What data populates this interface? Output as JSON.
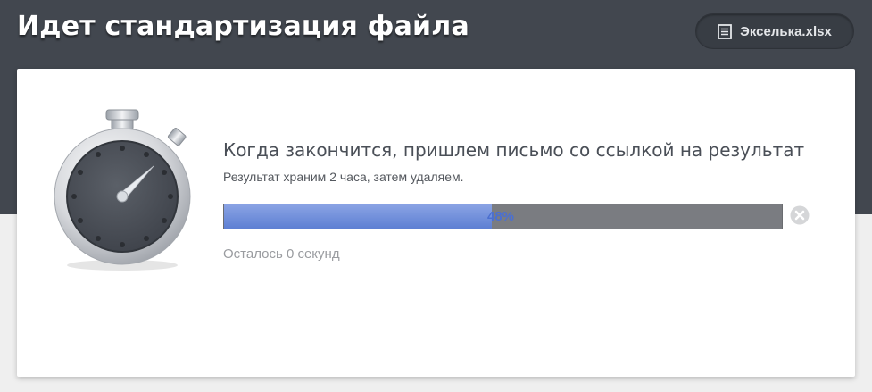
{
  "header": {
    "title": "Идет стандартизация файла",
    "file_name": "Экселька.xlsx",
    "file_icon": "document-icon"
  },
  "status": {
    "headline": "Когда закончится, пришлем письмо со ссылкой на результат",
    "note": "Результат храним 2 часа, затем удаляем.",
    "progress_percent": 48,
    "progress_label": "48%",
    "remaining": "Осталось 0 секунд",
    "cancel_icon": "close-circle-icon",
    "illustration_icon": "stopwatch-icon"
  },
  "colors": {
    "header_bg": "#42474f",
    "progress_fill": "#6f8ddb",
    "progress_track": "#7a7c81",
    "progress_text": "#4b6fd0"
  }
}
